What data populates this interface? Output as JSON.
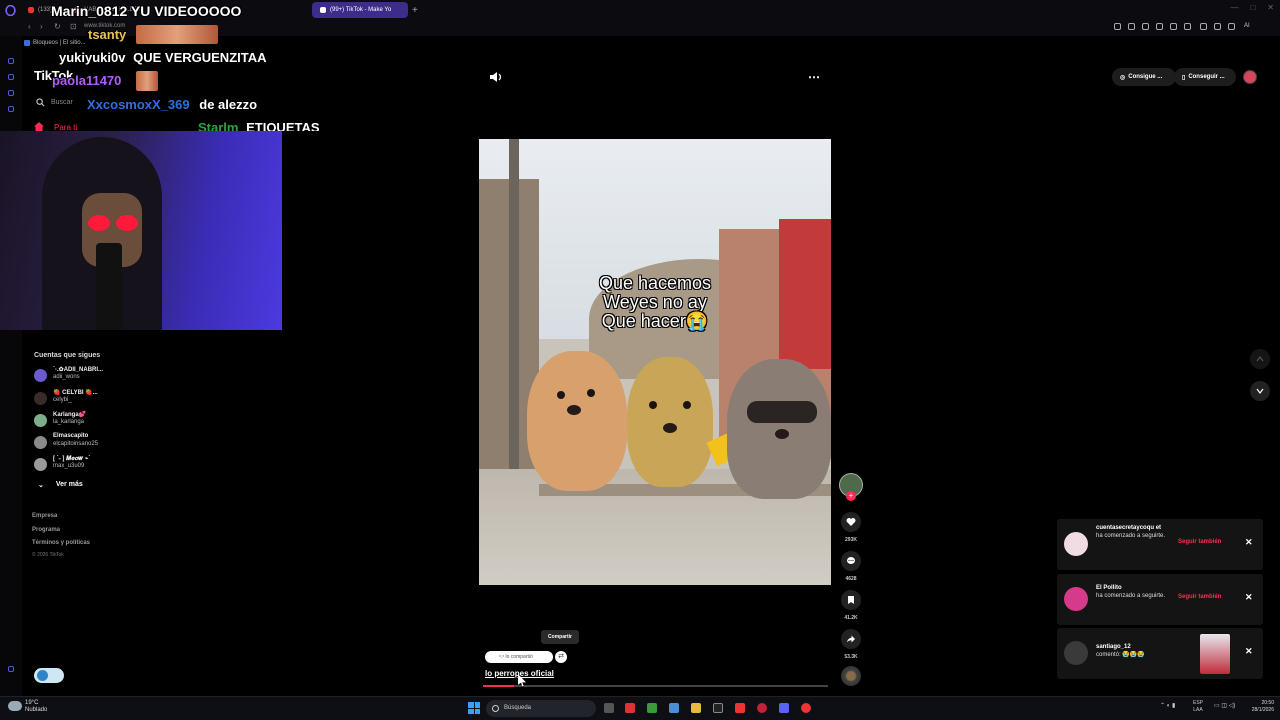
{
  "browser": {
    "tabs": [
      {
        "label": "(133)"
      },
      {
        "label": "NABI DAME PALETA"
      },
      {
        "label": "(99+) TikTok - Make Yo"
      }
    ],
    "new_tab": "+",
    "url": "www.tiktok.com",
    "bookmark": "Bloqueos | El sitio...",
    "ai_label": "AI",
    "window_controls": [
      "—",
      "□",
      "✕"
    ]
  },
  "tiktok": {
    "logo": "TikTok",
    "search_placeholder": "Buscar",
    "for_you": "Para ti",
    "top_buttons": [
      "Consigue ...",
      "Conseguir ..."
    ],
    "following_title": "Cuentas que sigues",
    "following": [
      {
        "name": "ˋ·.✿ADII_NABRI...",
        "user": "adii_wons"
      },
      {
        "name": "🍓 CELYBI 🍓...",
        "user": "celybi_"
      },
      {
        "name": "Karlanga💕",
        "user": "la_karlanga"
      },
      {
        "name": "Elmascapito",
        "user": "elcapitoinsano25"
      },
      {
        "name": "[ ˋ˗ ] 𝑴𝒆𝒐𝒘 ⌁ˋ",
        "user": "max_u3u09"
      }
    ],
    "see_more": "Ver más",
    "footer": [
      "Empresa",
      "Programa",
      "Términos y políticas"
    ],
    "copyright": "© 2026 TikTok"
  },
  "stream_chat": [
    {
      "user": "Marin_0812",
      "message": "YU VIDEOOOOO",
      "user_color": "#ffffff"
    },
    {
      "user": "tsanty",
      "message": "",
      "user_color": "#e8c35a"
    },
    {
      "user": "yukiyuki0v",
      "message": "QUE VERGUENZITAA",
      "user_color": "#ffffff"
    },
    {
      "user": "paola11470",
      "message": "",
      "user_color": "#b25cff"
    },
    {
      "user": "XxcosmoxX_369",
      "message": "de alezzo",
      "user_color": "#2f6fe0"
    },
    {
      "user": "Starlm",
      "message": "ETIQUETAS",
      "user_color": "#2ea043"
    }
  ],
  "video": {
    "caption_lines": [
      "Que hacemos",
      "Weyes no ay",
      "Que hacer😭"
    ],
    "author": "lo perropes oficial",
    "share_tooltip": "Compartir",
    "shared_chip": "ᵒ.ᵒ lo compartió",
    "progress": 0.09,
    "counts": {
      "likes": "293K",
      "comments": "4628",
      "saves": "41.2K",
      "shares": "53.3K"
    }
  },
  "notifications": [
    {
      "name": "cuentasecretaycoqu et",
      "text": "ha comenzado a seguirte.",
      "action": "Seguir también",
      "avatar_color": "#f0dce2"
    },
    {
      "name": "El Pollito",
      "text": "ha comenzado a seguirte.",
      "action": "Seguir también",
      "avatar_color": "#d63a8a"
    },
    {
      "name": "santiago_12",
      "text": "comentó: 😭😭😭",
      "action": "",
      "avatar_color": "#3a3a3a"
    }
  ],
  "taskbar": {
    "temperature": "19°C",
    "weather": "Nublado",
    "search": "Búsqueda",
    "lang_top": "ESP",
    "lang_bottom": "LAA",
    "time": "20:50",
    "date": "28/1/2026"
  },
  "colors": {
    "accent": "#fe2c55",
    "tab_active": "#3d2c8c"
  }
}
